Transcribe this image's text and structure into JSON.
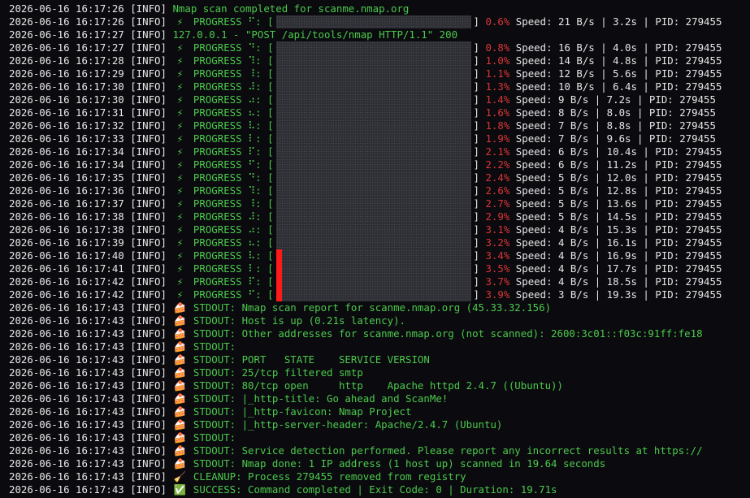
{
  "colors": {
    "background": "#0b0b0f",
    "green": "#4cc94c",
    "red": "#d93535",
    "bar_fill": "#ff1a1a"
  },
  "icons": {
    "progress": "lightning-icon",
    "stdout": "cake-icon",
    "cleanup": "broom-icon",
    "success": "check-icon"
  },
  "lines": [
    {
      "kind": "text",
      "ts": "2026-06-16 16:17:26",
      "lvl": "[INFO]",
      "msg": "Nmap scan completed for scanme.nmap.org",
      "color": "green"
    },
    {
      "kind": "progress",
      "ts": "2026-06-16 16:17:26",
      "lvl": "[INFO]",
      "icon": "⚡",
      "label": "PROGRESS",
      "spin": "⠋",
      "pct": "0.6%",
      "pct_value": 0.006,
      "rest": "Speed: 21 B/s | 3.2s | PID: 279455"
    },
    {
      "kind": "text",
      "ts": "2026-06-16 16:17:27",
      "lvl": "[INFO]",
      "msg": "127.0.0.1 - \"POST /api/tools/nmap HTTP/1.1\" 200",
      "color": "green"
    },
    {
      "kind": "progress",
      "ts": "2026-06-16 16:17:27",
      "lvl": "[INFO]",
      "icon": "⚡",
      "label": "PROGRESS",
      "spin": "⠙",
      "pct": "0.8%",
      "pct_value": 0.008,
      "rest": "Speed: 16 B/s | 4.0s | PID: 279455"
    },
    {
      "kind": "progress",
      "ts": "2026-06-16 16:17:28",
      "lvl": "[INFO]",
      "icon": "⚡",
      "label": "PROGRESS",
      "spin": "⠹",
      "pct": "1.0%",
      "pct_value": 0.01,
      "rest": "Speed: 14 B/s | 4.8s | PID: 279455"
    },
    {
      "kind": "progress",
      "ts": "2026-06-16 16:17:29",
      "lvl": "[INFO]",
      "icon": "⚡",
      "label": "PROGRESS",
      "spin": "⠸",
      "pct": "1.1%",
      "pct_value": 0.011,
      "rest": "Speed: 12 B/s | 5.6s | PID: 279455"
    },
    {
      "kind": "progress",
      "ts": "2026-06-16 16:17:30",
      "lvl": "[INFO]",
      "icon": "⚡",
      "label": "PROGRESS",
      "spin": "⠼",
      "pct": "1.3%",
      "pct_value": 0.013,
      "rest": "Speed: 10 B/s | 6.4s | PID: 279455"
    },
    {
      "kind": "progress",
      "ts": "2026-06-16 16:17:30",
      "lvl": "[INFO]",
      "icon": "⚡",
      "label": "PROGRESS",
      "spin": "⠴",
      "pct": "1.4%",
      "pct_value": 0.014,
      "rest": "Speed: 9 B/s | 7.2s | PID: 279455"
    },
    {
      "kind": "progress",
      "ts": "2026-06-16 16:17:31",
      "lvl": "[INFO]",
      "icon": "⚡",
      "label": "PROGRESS",
      "spin": "⠦",
      "pct": "1.6%",
      "pct_value": 0.016,
      "rest": "Speed: 8 B/s | 8.0s | PID: 279455"
    },
    {
      "kind": "progress",
      "ts": "2026-06-16 16:17:32",
      "lvl": "[INFO]",
      "icon": "⚡",
      "label": "PROGRESS",
      "spin": "⠧",
      "pct": "1.8%",
      "pct_value": 0.018,
      "rest": "Speed: 7 B/s | 8.8s | PID: 279455"
    },
    {
      "kind": "progress",
      "ts": "2026-06-16 16:17:33",
      "lvl": "[INFO]",
      "icon": "⚡",
      "label": "PROGRESS",
      "spin": "⠇",
      "pct": "1.9%",
      "pct_value": 0.019,
      "rest": "Speed: 7 B/s | 9.6s | PID: 279455"
    },
    {
      "kind": "progress",
      "ts": "2026-06-16 16:17:34",
      "lvl": "[INFO]",
      "icon": "⚡",
      "label": "PROGRESS",
      "spin": "⠏",
      "pct": "2.1%",
      "pct_value": 0.021,
      "rest": "Speed: 6 B/s | 10.4s | PID: 279455"
    },
    {
      "kind": "progress",
      "ts": "2026-06-16 16:17:34",
      "lvl": "[INFO]",
      "icon": "⚡",
      "label": "PROGRESS",
      "spin": "⠋",
      "pct": "2.2%",
      "pct_value": 0.022,
      "rest": "Speed: 6 B/s | 11.2s | PID: 279455"
    },
    {
      "kind": "progress",
      "ts": "2026-06-16 16:17:35",
      "lvl": "[INFO]",
      "icon": "⚡",
      "label": "PROGRESS",
      "spin": "⠙",
      "pct": "2.4%",
      "pct_value": 0.024,
      "rest": "Speed: 5 B/s | 12.0s | PID: 279455"
    },
    {
      "kind": "progress",
      "ts": "2026-06-16 16:17:36",
      "lvl": "[INFO]",
      "icon": "⚡",
      "label": "PROGRESS",
      "spin": "⠹",
      "pct": "2.6%",
      "pct_value": 0.026,
      "rest": "Speed: 5 B/s | 12.8s | PID: 279455"
    },
    {
      "kind": "progress",
      "ts": "2026-06-16 16:17:37",
      "lvl": "[INFO]",
      "icon": "⚡",
      "label": "PROGRESS",
      "spin": "⠸",
      "pct": "2.7%",
      "pct_value": 0.027,
      "rest": "Speed: 5 B/s | 13.6s | PID: 279455"
    },
    {
      "kind": "progress",
      "ts": "2026-06-16 16:17:38",
      "lvl": "[INFO]",
      "icon": "⚡",
      "label": "PROGRESS",
      "spin": "⠼",
      "pct": "2.9%",
      "pct_value": 0.029,
      "rest": "Speed: 5 B/s | 14.5s | PID: 279455"
    },
    {
      "kind": "progress",
      "ts": "2026-06-16 16:17:38",
      "lvl": "[INFO]",
      "icon": "⚡",
      "label": "PROGRESS",
      "spin": "⠴",
      "pct": "3.1%",
      "pct_value": 0.031,
      "rest": "Speed: 4 B/s | 15.3s | PID: 279455"
    },
    {
      "kind": "progress",
      "ts": "2026-06-16 16:17:39",
      "lvl": "[INFO]",
      "icon": "⚡",
      "label": "PROGRESS",
      "spin": "⠦",
      "pct": "3.2%",
      "pct_value": 0.032,
      "rest": "Speed: 4 B/s | 16.1s | PID: 279455"
    },
    {
      "kind": "progress",
      "ts": "2026-06-16 16:17:40",
      "lvl": "[INFO]",
      "icon": "⚡",
      "label": "PROGRESS",
      "spin": "⠧",
      "pct": "3.4%",
      "pct_value": 0.034,
      "rest": "Speed: 4 B/s | 16.9s | PID: 279455"
    },
    {
      "kind": "progress",
      "ts": "2026-06-16 16:17:41",
      "lvl": "[INFO]",
      "icon": "⚡",
      "label": "PROGRESS",
      "spin": "⠇",
      "pct": "3.5%",
      "pct_value": 0.035,
      "rest": "Speed: 4 B/s | 17.7s | PID: 279455"
    },
    {
      "kind": "progress",
      "ts": "2026-06-16 16:17:42",
      "lvl": "[INFO]",
      "icon": "⚡",
      "label": "PROGRESS",
      "spin": "⠏",
      "pct": "3.7%",
      "pct_value": 0.037,
      "rest": "Speed: 4 B/s | 18.5s | PID: 279455"
    },
    {
      "kind": "progress",
      "ts": "2026-06-16 16:17:42",
      "lvl": "[INFO]",
      "icon": "⚡",
      "label": "PROGRESS",
      "spin": "⠋",
      "pct": "3.9%",
      "pct_value": 0.039,
      "rest": "Speed: 3 B/s | 19.3s | PID: 279455"
    },
    {
      "kind": "text",
      "ts": "2026-06-16 16:17:43",
      "lvl": "[INFO]",
      "icon": "🍰",
      "msg": "STDOUT: Nmap scan report for scanme.nmap.org (45.33.32.156)",
      "color": "green"
    },
    {
      "kind": "text",
      "ts": "2026-06-16 16:17:43",
      "lvl": "[INFO]",
      "icon": "🍰",
      "msg": "STDOUT: Host is up (0.21s latency).",
      "color": "green"
    },
    {
      "kind": "text",
      "ts": "2026-06-16 16:17:43",
      "lvl": "[INFO]",
      "icon": "🍰",
      "msg": "STDOUT: Other addresses for scanme.nmap.org (not scanned): 2600:3c01::f03c:91ff:fe18",
      "color": "green"
    },
    {
      "kind": "text",
      "ts": "2026-06-16 16:17:43",
      "lvl": "[INFO]",
      "icon": "🍰",
      "msg": "STDOUT:",
      "color": "green"
    },
    {
      "kind": "text",
      "ts": "2026-06-16 16:17:43",
      "lvl": "[INFO]",
      "icon": "🍰",
      "msg": "STDOUT: PORT   STATE    SERVICE VERSION",
      "color": "green"
    },
    {
      "kind": "text",
      "ts": "2026-06-16 16:17:43",
      "lvl": "[INFO]",
      "icon": "🍰",
      "msg": "STDOUT: 25/tcp filtered smtp",
      "color": "green"
    },
    {
      "kind": "text",
      "ts": "2026-06-16 16:17:43",
      "lvl": "[INFO]",
      "icon": "🍰",
      "msg": "STDOUT: 80/tcp open     http    Apache httpd 2.4.7 ((Ubuntu))",
      "color": "green"
    },
    {
      "kind": "text",
      "ts": "2026-06-16 16:17:43",
      "lvl": "[INFO]",
      "icon": "🍰",
      "msg": "STDOUT: |_http-title: Go ahead and ScanMe!",
      "color": "green"
    },
    {
      "kind": "text",
      "ts": "2026-06-16 16:17:43",
      "lvl": "[INFO]",
      "icon": "🍰",
      "msg": "STDOUT: |_http-favicon: Nmap Project",
      "color": "green"
    },
    {
      "kind": "text",
      "ts": "2026-06-16 16:17:43",
      "lvl": "[INFO]",
      "icon": "🍰",
      "msg": "STDOUT: |_http-server-header: Apache/2.4.7 (Ubuntu)",
      "color": "green"
    },
    {
      "kind": "text",
      "ts": "2026-06-16 16:17:43",
      "lvl": "[INFO]",
      "icon": "🍰",
      "msg": "STDOUT:",
      "color": "green"
    },
    {
      "kind": "text",
      "ts": "2026-06-16 16:17:43",
      "lvl": "[INFO]",
      "icon": "🍰",
      "msg": "STDOUT: Service detection performed. Please report any incorrect results at https://",
      "color": "green"
    },
    {
      "kind": "text",
      "ts": "2026-06-16 16:17:43",
      "lvl": "[INFO]",
      "icon": "🍰",
      "msg": "STDOUT: Nmap done: 1 IP address (1 host up) scanned in 19.64 seconds",
      "color": "green"
    },
    {
      "kind": "text",
      "ts": "2026-06-16 16:17:43",
      "lvl": "[INFO]",
      "icon": "🧹",
      "msg": "CLEANUP: Process 279455 removed from registry",
      "color": "green"
    },
    {
      "kind": "text",
      "ts": "2026-06-16 16:17:43",
      "lvl": "[INFO]",
      "icon": "✅",
      "msg": "SUCCESS: Command completed | Exit Code: 0 | Duration: 19.71s",
      "color": "green"
    }
  ]
}
